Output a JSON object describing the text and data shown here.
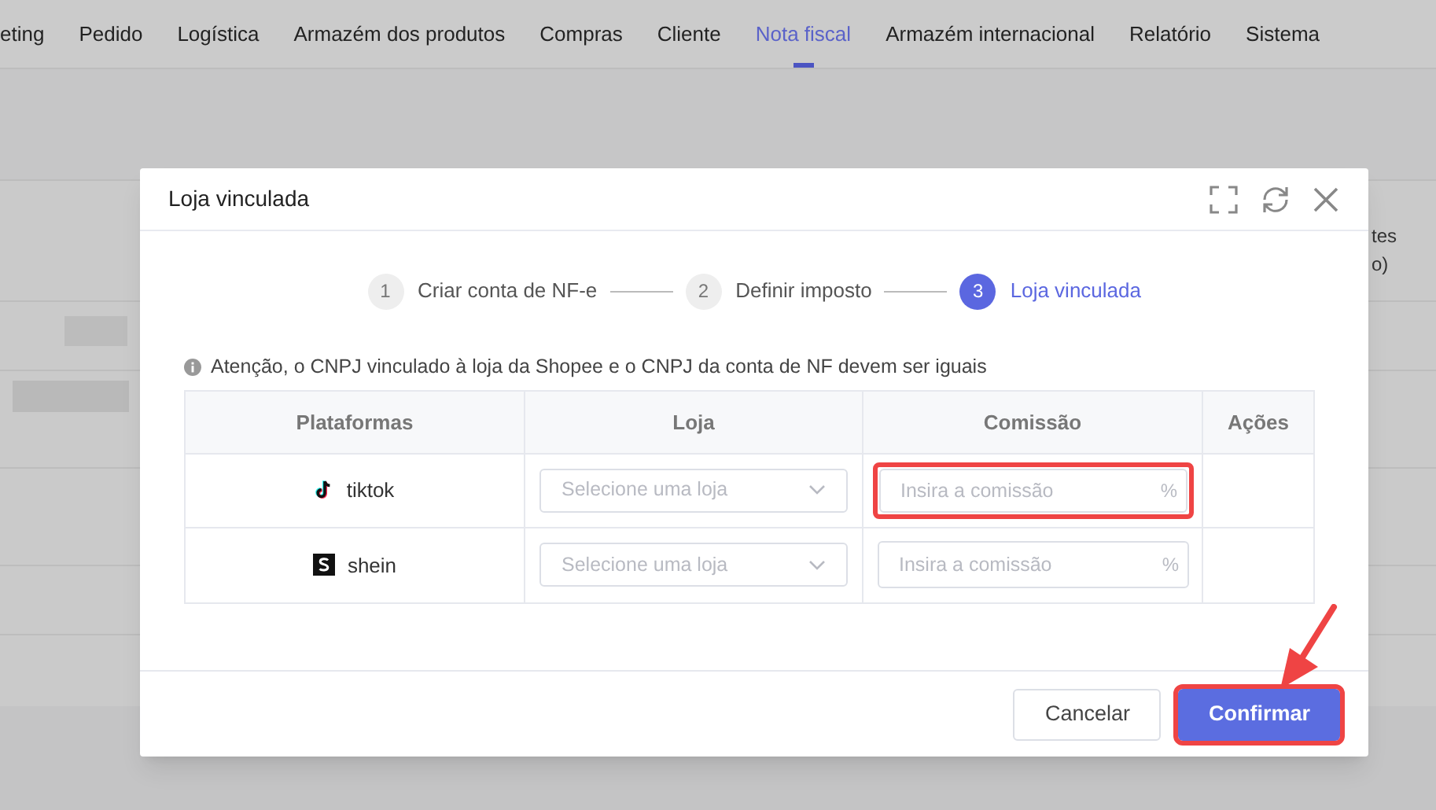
{
  "nav": [
    {
      "label": "eting",
      "selected": false
    },
    {
      "label": "Pedido",
      "selected": false
    },
    {
      "label": "Logística",
      "selected": false
    },
    {
      "label": "Armazém dos produtos",
      "selected": false
    },
    {
      "label": "Compras",
      "selected": false
    },
    {
      "label": "Cliente",
      "selected": false
    },
    {
      "label": "Nota fiscal",
      "selected": true
    },
    {
      "label": "Armazém internacional",
      "selected": false
    },
    {
      "label": "Relatório",
      "selected": false
    },
    {
      "label": "Sistema",
      "selected": false
    }
  ],
  "background_header_fragment": [
    "tes",
    "o)"
  ],
  "dialog": {
    "title": "Loja vinculada",
    "steps": [
      {
        "number": "1",
        "label": "Criar conta de NF-e",
        "selected": false
      },
      {
        "number": "2",
        "label": "Definir imposto",
        "selected": false
      },
      {
        "number": "3",
        "label": "Loja vinculada",
        "selected": true
      }
    ],
    "notice": "Atenção, o CNPJ vinculado à loja da Shopee e o CNPJ da conta de NF devem ser iguais",
    "table": {
      "columns": [
        "Plataformas",
        "Loja",
        "Comissão",
        "Ações"
      ],
      "rows": [
        {
          "platform": "tiktok",
          "kind": "tiktok",
          "store_placeholder": "Selecione uma loja",
          "commission_placeholder": "Insira a comissão",
          "unit": "%",
          "highlighted": true
        },
        {
          "platform": "shein",
          "kind": "shein",
          "store_placeholder": "Selecione uma loja",
          "commission_placeholder": "Insira a comissão",
          "unit": "%",
          "highlighted": false
        }
      ]
    },
    "buttons": [
      {
        "label": "Cancelar",
        "kind": "secondary",
        "highlighted": false
      },
      {
        "label": "Confirmar",
        "kind": "primary",
        "highlighted": true
      }
    ]
  },
  "annotation_arrow": true
}
